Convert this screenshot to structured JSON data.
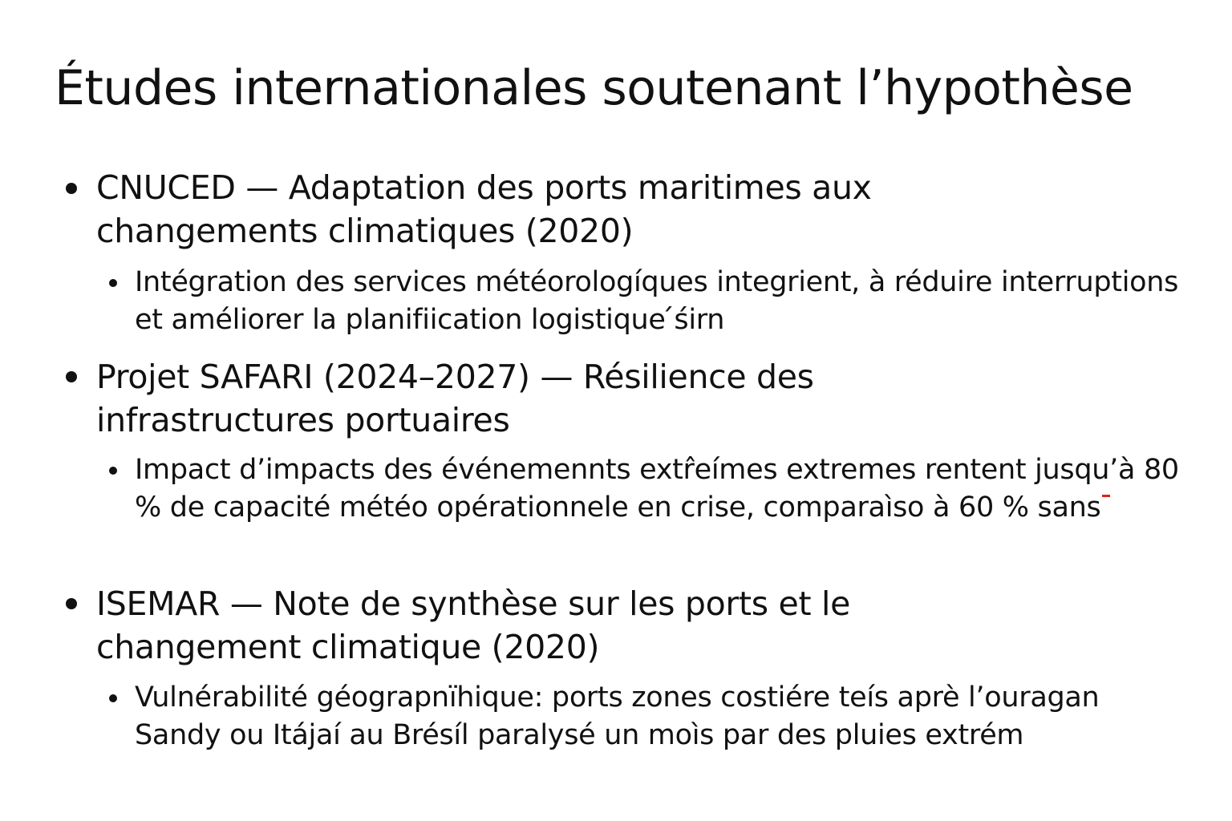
{
  "title": "Études internationales soutenant l’hypothèse",
  "items": [
    {
      "heading": "CNUCED — Adaptation des ports maritimes aux changements climatiques (2020)",
      "sub": "Intégration des services météorologíques integrient, à réduire interruptions et améliorer la planifiication logistique ́śirn"
    },
    {
      "heading": "Projet SAFARI (2024–2027) — Résilience des infrastructures portuaires",
      "sub": "Impact d’impacts des événemennts extr̂eímes extremes rentent jusqu’à 80 % de capacité météo opérationnele en crise, comparaìso à 60 % sans"
    },
    {
      "heading": "ISEMAR — Note de synthèse sur les ports et le changement climatique (2020)",
      "sub": "Vulnérabilité géograpnïhique:  ports zones costiére teís aprè l’ouragan Sandy ou  Itájaí au Brésíl paralysé un moìs par des pluies extrém"
    }
  ]
}
